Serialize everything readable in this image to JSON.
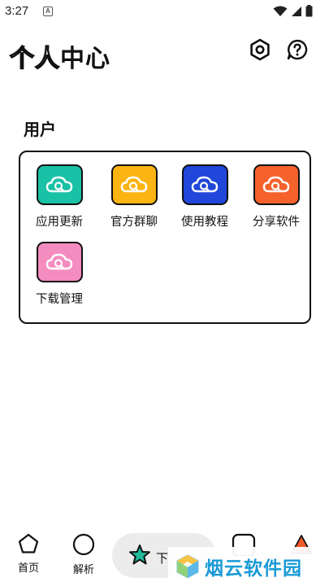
{
  "status_bar": {
    "time": "3:27",
    "notification_glyph": "A"
  },
  "header": {
    "title_outline": "个人",
    "title_solid": "中心",
    "settings_icon": "hexagon-nut-icon",
    "help_icon": "help-bubble-icon"
  },
  "section": {
    "title": "用户"
  },
  "tools": [
    {
      "label": "应用更新",
      "color": "#19c1a6",
      "icon": "cloud-search-icon"
    },
    {
      "label": "官方群聊",
      "color": "#fbb412",
      "icon": "cloud-search-icon"
    },
    {
      "label": "使用教程",
      "color": "#2047d9",
      "icon": "cloud-search-icon"
    },
    {
      "label": "分享软件",
      "color": "#f5622c",
      "icon": "cloud-search-icon"
    },
    {
      "label": "下载管理",
      "color": "#f58cc0",
      "icon": "cloud-search-icon"
    }
  ],
  "bottom_nav": {
    "home_label": "首页",
    "parse_label": "解析",
    "active_label": "下"
  },
  "watermark": {
    "text": "烟云软件园"
  },
  "colors": {
    "accent_teal": "#1fb99a",
    "nav_active_bg": "#ececec",
    "watermark_blue": "#1a9ad6"
  }
}
